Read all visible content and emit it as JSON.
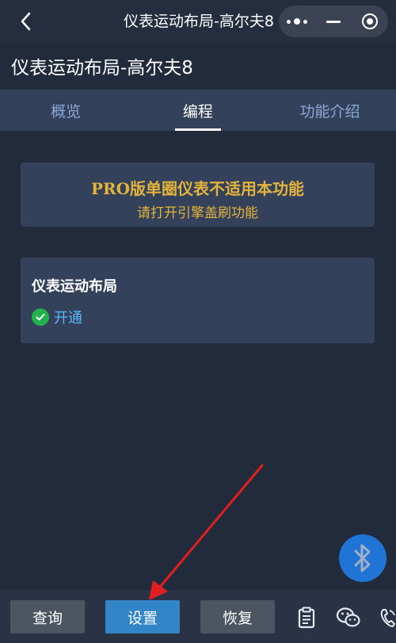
{
  "nav": {
    "title": "仪表运动布局-高尔夫8"
  },
  "header": {
    "title": "仪表运动布局-高尔夫8"
  },
  "tabs": [
    {
      "label": "概览",
      "active": false
    },
    {
      "label": "编程",
      "active": true
    },
    {
      "label": "功能介绍",
      "active": false
    }
  ],
  "notice": {
    "title": "PRO版单圈仪表不适用本功能",
    "subtitle": "请打开引擎盖刷功能"
  },
  "feature": {
    "title": "仪表运动布局",
    "status": "开通"
  },
  "bottom_bar": {
    "query_label": "查询",
    "settings_label": "设置",
    "restore_label": "恢复"
  },
  "colors": {
    "background": "#222b3b",
    "card": "#34415a",
    "accent_gold": "#e3b43c",
    "status_blue": "#56b8ff",
    "check_green": "#22b14c",
    "primary_button": "#3286c8",
    "bluetooth_button": "#1f74d6",
    "annotation_arrow": "#e11f1f"
  },
  "icons": [
    "back-icon",
    "more-dots-icon",
    "minimize-icon",
    "close-target-icon",
    "check-circle-icon",
    "bluetooth-icon",
    "clipboard-icon",
    "wechat-icon",
    "phone-icon"
  ]
}
